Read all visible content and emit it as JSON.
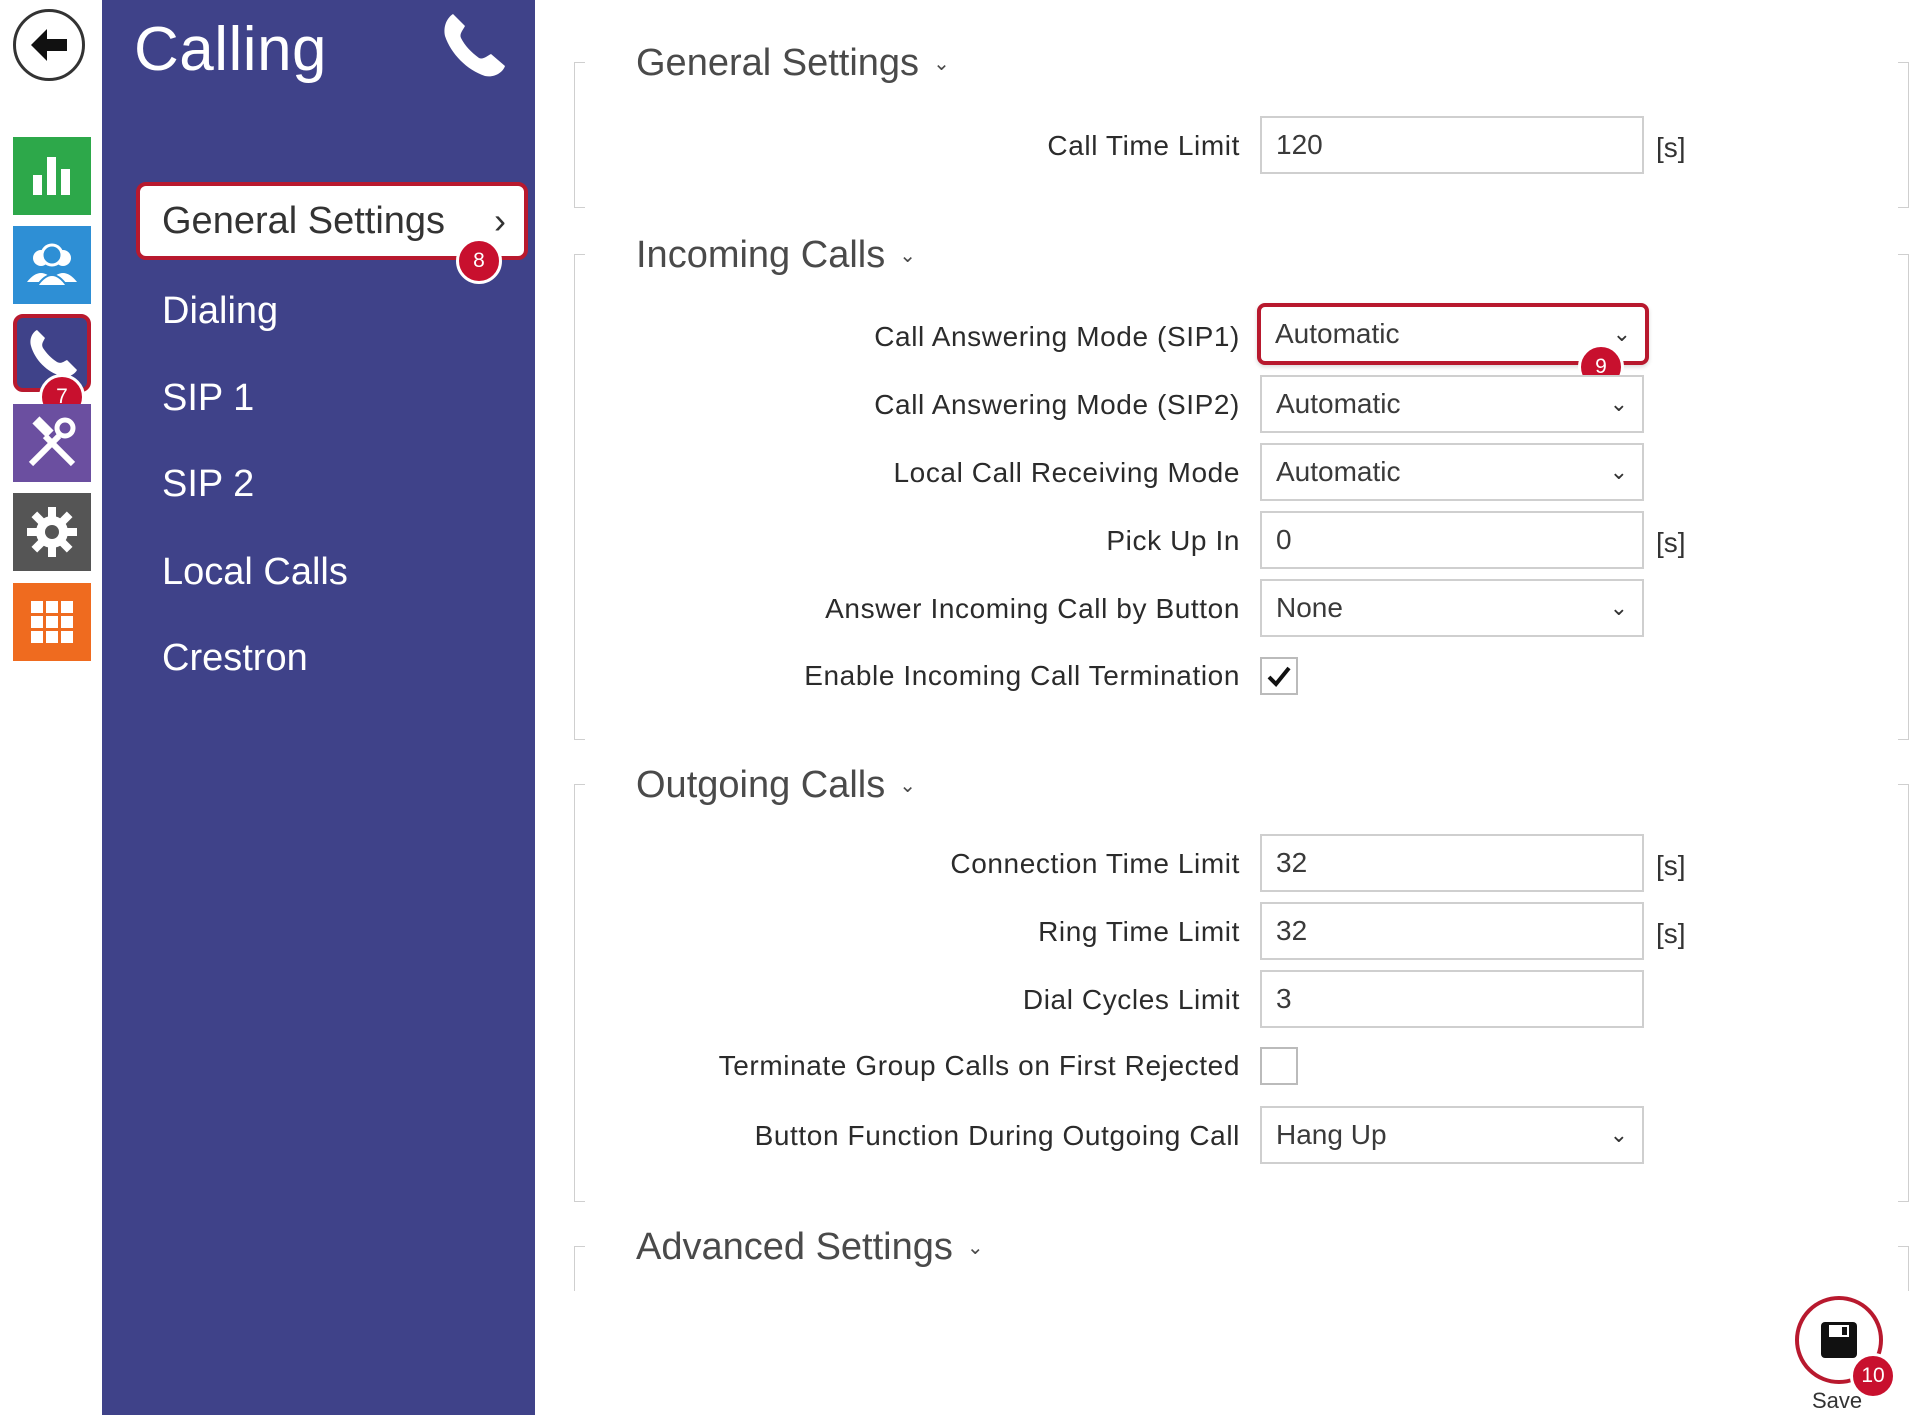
{
  "nav": {
    "title": "Calling",
    "items": [
      {
        "label": "General Settings",
        "active": true
      },
      {
        "label": "Dialing"
      },
      {
        "label": "SIP 1"
      },
      {
        "label": "SIP 2"
      },
      {
        "label": "Local Calls"
      },
      {
        "label": "Crestron"
      }
    ]
  },
  "rail": {
    "icons": [
      "back-arrow-icon",
      "status-chart-icon",
      "directory-users-icon",
      "calling-phone-icon",
      "hardware-tools-icon",
      "system-gear-icon",
      "services-grid-icon"
    ],
    "colors": {
      "green": "#2da84a",
      "blue": "#2e8fd5",
      "navy": "#3f4289",
      "purple": "#6b4fa0",
      "gray": "#555555",
      "orange": "#ef6b1f"
    }
  },
  "badges": {
    "b7": "7",
    "b8": "8",
    "b9": "9",
    "b10": "10"
  },
  "sections": {
    "general": {
      "title": "General Settings",
      "call_time_limit": {
        "label": "Call Time Limit",
        "value": "120",
        "unit": "[s]"
      }
    },
    "incoming": {
      "title": "Incoming Calls",
      "sip1_mode": {
        "label": "Call Answering Mode (SIP1)",
        "value": "Automatic"
      },
      "sip2_mode": {
        "label": "Call Answering Mode (SIP2)",
        "value": "Automatic"
      },
      "local_mode": {
        "label": "Local Call Receiving Mode",
        "value": "Automatic"
      },
      "pick_up_in": {
        "label": "Pick Up In",
        "value": "0",
        "unit": "[s]"
      },
      "answer_by_button": {
        "label": "Answer Incoming Call by Button",
        "value": "None"
      },
      "enable_termination": {
        "label": "Enable Incoming Call Termination",
        "checked": true
      }
    },
    "outgoing": {
      "title": "Outgoing Calls",
      "connection_time_limit": {
        "label": "Connection Time Limit",
        "value": "32",
        "unit": "[s]"
      },
      "ring_time_limit": {
        "label": "Ring Time Limit",
        "value": "32",
        "unit": "[s]"
      },
      "dial_cycles_limit": {
        "label": "Dial Cycles Limit",
        "value": "3"
      },
      "terminate_group": {
        "label": "Terminate Group Calls on First Rejected",
        "checked": false
      },
      "button_function": {
        "label": "Button Function During Outgoing Call",
        "value": "Hang Up"
      }
    },
    "advanced": {
      "title": "Advanced Settings"
    }
  },
  "save": {
    "label": "Save"
  },
  "accent_color": "#b8192e"
}
